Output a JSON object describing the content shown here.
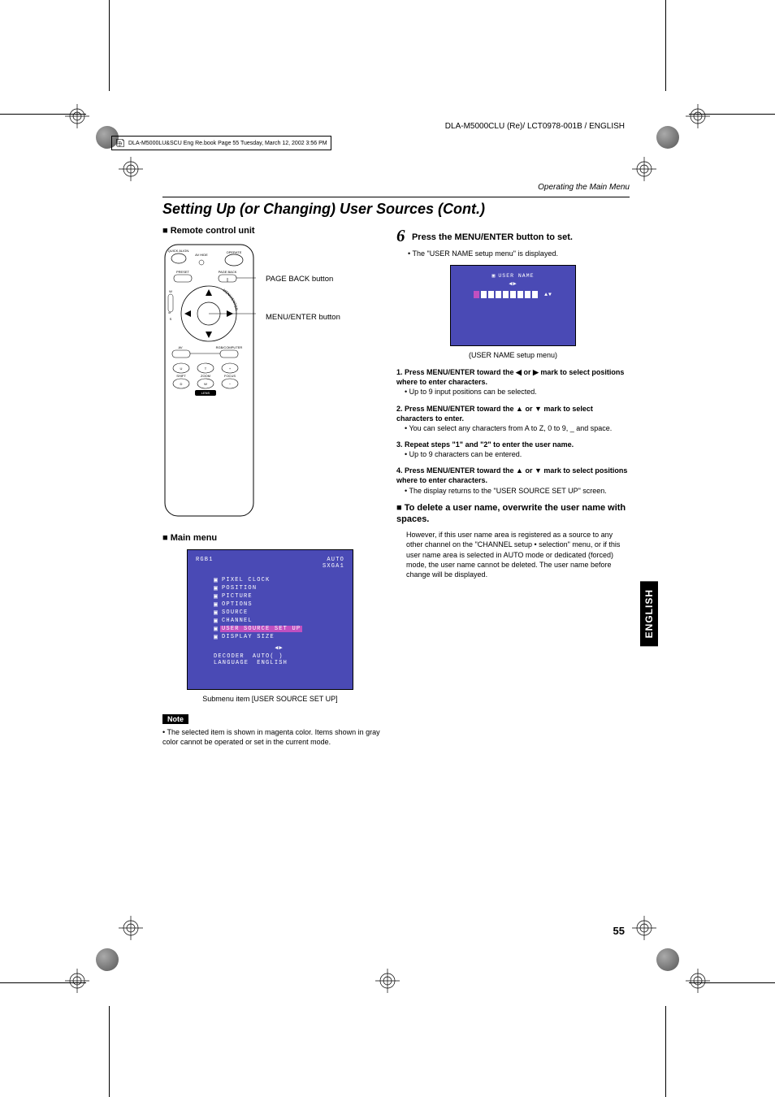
{
  "doc_header": "DLA-M5000CLU (Re)/ LCT0978-001B / ENGLISH",
  "book_info": "DLA-M5000LU&SCU Eng Re.book  Page 55  Tuesday, March 12, 2002  3:56 PM",
  "breadcrumb": "Operating the Main Menu",
  "section_title": "Setting Up (or Changing) User Sources (Cont.)",
  "left": {
    "remote_heading": "Remote control unit",
    "remote_labels": {
      "quick_align": "QUICK ALIGN.",
      "av_hide": "AV HIDE",
      "operate": "OPERATE",
      "preset": "PRESET",
      "page_back": "PAGE BACK",
      "screen_side": "SCREEN",
      "w": "W",
      "s": "S",
      "menu_enter": "MENU/ENTER",
      "av": "AV",
      "rgb_computer": "RGB/COMPUTER",
      "shift": "SHIFT",
      "zoom": "ZOOM",
      "focus": "FOCUS",
      "lens": "LENS",
      "u_btn": "U",
      "t_btn": "T",
      "plus_btn": "+",
      "d_btn": "D",
      "w_btn": "W",
      "minus_btn": "−"
    },
    "callout1": "PAGE BACK button",
    "callout2": "MENU/ENTER button",
    "main_menu_heading": "Main menu",
    "screen": {
      "top_left": "RGB1",
      "top_right1": "AUTO",
      "top_right2": "SXGA1",
      "items": {
        "pixel_clock": "PIXEL CLOCK",
        "position": "POSITION",
        "picture": "PICTURE",
        "options": "OPTIONS",
        "source": "SOURCE",
        "channel": "CHANNEL",
        "user_source": "USER SOURCE SET UP",
        "display_size": "DISPLAY SIZE"
      },
      "arrows": "◀▶",
      "decoder_label": "DECODER",
      "decoder_value": "AUTO(      )",
      "language_label": "LANGUAGE",
      "language_value": "ENGLISH"
    },
    "screen_caption": "Submenu item [USER SOURCE SET UP]",
    "note_label": "Note",
    "note_text": "• The selected item is shown in magenta color. Items shown in gray color cannot be operated or set in the current mode."
  },
  "right": {
    "step_num": "6",
    "step_text": "Press the MENU/ENTER button to set.",
    "step_bullet": "• The \"USER NAME setup menu\" is displayed.",
    "mini_screen": {
      "title": "USER NAME",
      "arrows_above": "◀▶",
      "arrows_side": "▲▼"
    },
    "mini_caption": "(USER NAME setup menu)",
    "steps": {
      "s1a": "1. Press MENU/ENTER toward the ◀ or ▶ mark to select positions where to enter characters.",
      "s1b": "• Up to 9 input positions can be selected.",
      "s2a": "2. Press MENU/ENTER toward the ▲ or ▼ mark to select characters to enter.",
      "s2b": "• You can select any characters from A to Z, 0 to 9, _ and space.",
      "s3a": "3. Repeat steps \"1\" and \"2\" to enter the user name.",
      "s3b": "• Up to 9 characters can be entered.",
      "s4a": "4. Press MENU/ENTER toward the ▲ or ▼ mark to select positions where to enter characters.",
      "s4b": "• The display returns to the \"USER SOURCE SET UP\" screen."
    },
    "delete_heading": "To delete a user name, overwrite the user name with spaces.",
    "delete_para": "However, if this user name area is registered as a source to any other channel on the \"CHANNEL setup • selection\" menu, or if this user name area is selected in AUTO mode or dedicated (forced) mode, the user name cannot be deleted. The user name before change will be displayed."
  },
  "english_tab": "ENGLISH",
  "page_num": "55"
}
